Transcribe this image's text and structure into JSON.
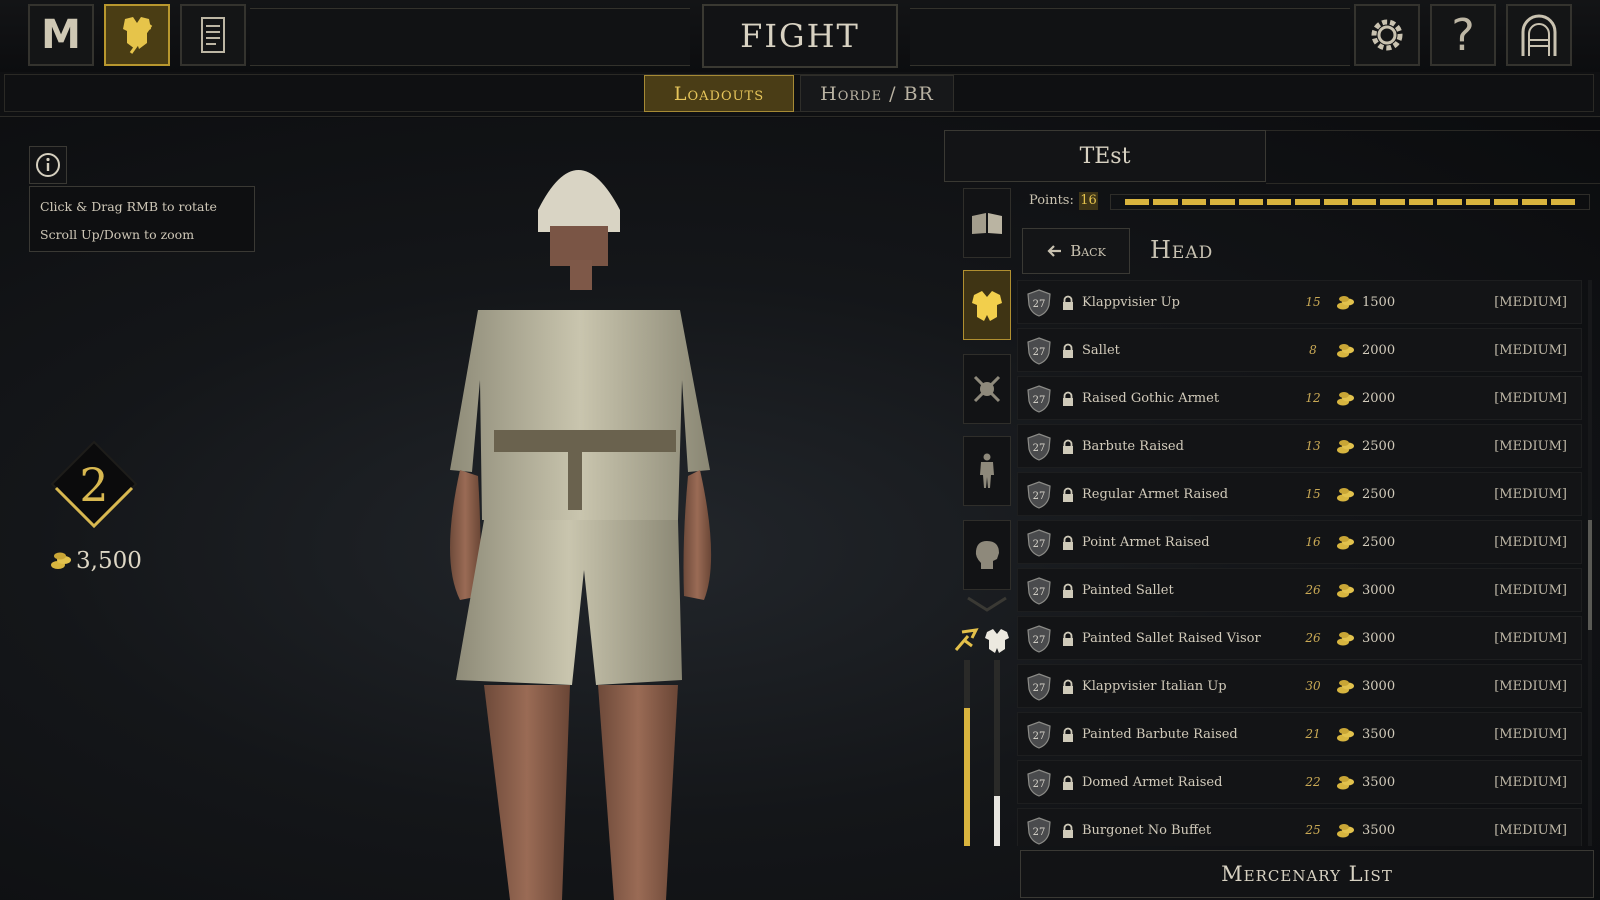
{
  "top_bar": {
    "title": "FIGHT",
    "buttons": [
      {
        "icon": "mordhau-logo-icon",
        "label": "M"
      },
      {
        "icon": "armor-customize-icon"
      },
      {
        "icon": "scroll-icon"
      },
      {
        "icon": "gear-icon"
      },
      {
        "icon": "help-icon",
        "label": "?"
      },
      {
        "icon": "door-exit-icon"
      }
    ]
  },
  "tabs": [
    {
      "label": "Loadouts",
      "active": true
    },
    {
      "label": "Horde / BR",
      "active": false
    }
  ],
  "info": {
    "hint_rotate": "Click & Drag RMB to rotate",
    "hint_zoom": "Scroll Up/Down to zoom"
  },
  "player": {
    "level": "2",
    "gold": "3,500"
  },
  "loadout": {
    "name": "TEst",
    "points_label": "Points:",
    "points_value": "16",
    "points_segments": 16,
    "back_label": "Back",
    "section_title": "Head",
    "category_icons": [
      "book-icon",
      "armor-icon",
      "weapons-icon",
      "body-icon",
      "head-icon"
    ],
    "meter_icons": [
      "speed-icon",
      "armor-stat-icon"
    ],
    "speed_meter": 0.74,
    "armor_meter": 0.27,
    "items": [
      {
        "level": "27",
        "name": "Klappvisier Up",
        "points": "15",
        "price": "1500",
        "tier": "[MEDIUM]"
      },
      {
        "level": "27",
        "name": "Sallet",
        "points": "8",
        "price": "2000",
        "tier": "[MEDIUM]"
      },
      {
        "level": "27",
        "name": "Raised Gothic Armet",
        "points": "12",
        "price": "2000",
        "tier": "[MEDIUM]"
      },
      {
        "level": "27",
        "name": "Barbute Raised",
        "points": "13",
        "price": "2500",
        "tier": "[MEDIUM]"
      },
      {
        "level": "27",
        "name": "Regular Armet Raised",
        "points": "15",
        "price": "2500",
        "tier": "[MEDIUM]"
      },
      {
        "level": "27",
        "name": "Point Armet Raised",
        "points": "16",
        "price": "2500",
        "tier": "[MEDIUM]"
      },
      {
        "level": "27",
        "name": "Painted Sallet",
        "points": "26",
        "price": "3000",
        "tier": "[MEDIUM]"
      },
      {
        "level": "27",
        "name": "Painted Sallet Raised Visor",
        "points": "26",
        "price": "3000",
        "tier": "[MEDIUM]"
      },
      {
        "level": "27",
        "name": "Klappvisier Italian Up",
        "points": "30",
        "price": "3000",
        "tier": "[MEDIUM]"
      },
      {
        "level": "27",
        "name": "Painted Barbute Raised",
        "points": "21",
        "price": "3500",
        "tier": "[MEDIUM]"
      },
      {
        "level": "27",
        "name": "Domed Armet Raised",
        "points": "22",
        "price": "3500",
        "tier": "[MEDIUM]"
      },
      {
        "level": "27",
        "name": "Burgonet No Buffet",
        "points": "25",
        "price": "3500",
        "tier": "[MEDIUM]"
      }
    ],
    "mercenary_label": "Mercenary List"
  },
  "colors": {
    "accent_gold": "#d9b43e",
    "active_bg": "#4a3d16",
    "panel_bg": "#131416"
  }
}
